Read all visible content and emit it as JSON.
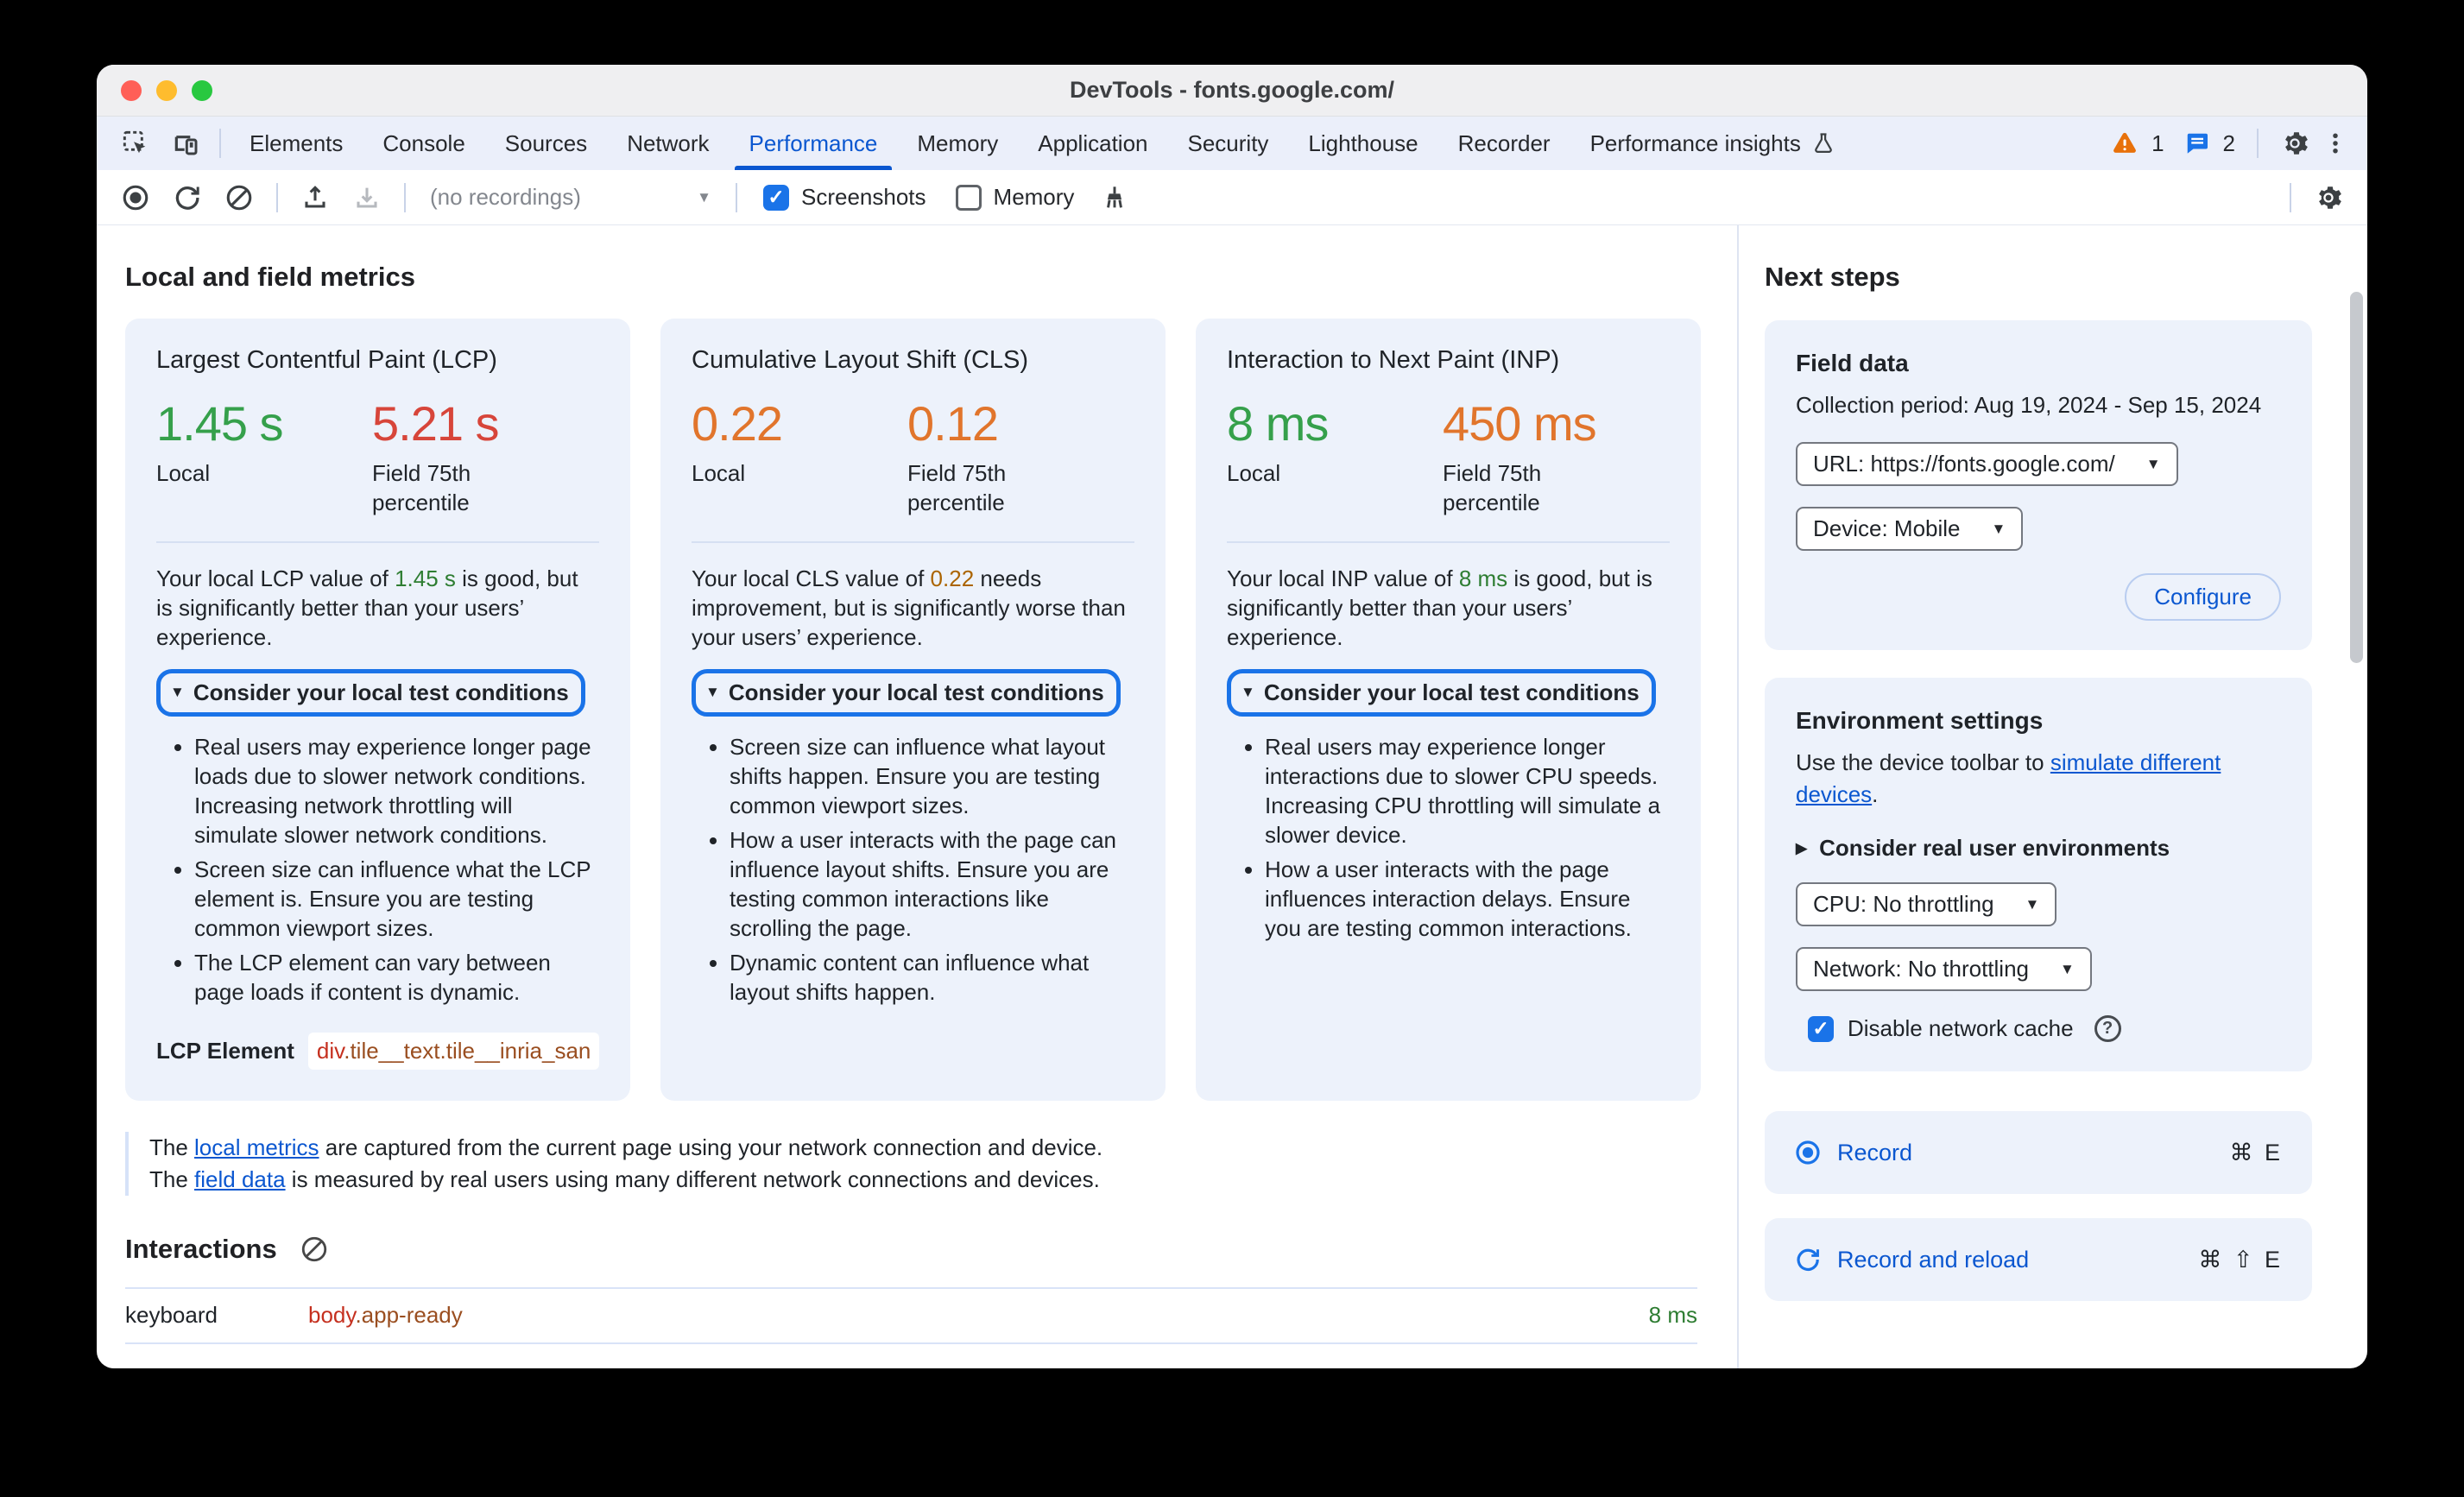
{
  "colors": {
    "accent_blue": "#1a73e8",
    "link_blue": "#0b57d0",
    "good_green": "#35a04b",
    "poor_red": "#d7453a",
    "needs_improvement_orange": "#e1752c",
    "warning_orange": "#e8710a"
  },
  "window": {
    "title": "DevTools - fonts.google.com/"
  },
  "tabbar": {
    "tabs": [
      {
        "label": "Elements"
      },
      {
        "label": "Console"
      },
      {
        "label": "Sources"
      },
      {
        "label": "Network"
      },
      {
        "label": "Performance"
      },
      {
        "label": "Memory"
      },
      {
        "label": "Application"
      },
      {
        "label": "Security"
      },
      {
        "label": "Lighthouse"
      },
      {
        "label": "Recorder"
      },
      {
        "label": "Performance insights"
      }
    ],
    "warning_count": "1",
    "message_count": "2"
  },
  "toolbar": {
    "recordings_select": "(no recordings)",
    "screenshots_label": "Screenshots",
    "memory_label": "Memory"
  },
  "main": {
    "heading": "Local and field metrics",
    "cards": [
      {
        "title": "Largest Contentful Paint (LCP)",
        "local_value": "1.45 s",
        "local_label": "Local",
        "field_value": "5.21 s",
        "field_label": "Field 75th percentile",
        "desc_prefix": "Your local LCP value of ",
        "desc_value": "1.45 s",
        "desc_suffix": " is good, but is significantly better than your users’ experience.",
        "disclosure": "Consider your local test conditions",
        "bullets": [
          "Real users may experience longer page loads due to slower network conditions. Increasing network throttling will simulate slower network conditions.",
          "Screen size can influence what the LCP element is. Ensure you are testing common viewport sizes.",
          "The LCP element can vary between page loads if content is dynamic."
        ],
        "lcp_label": "LCP Element",
        "lcp_tag": "div",
        "lcp_classes": ".tile__text.tile__inria_san"
      },
      {
        "title": "Cumulative Layout Shift (CLS)",
        "local_value": "0.22",
        "local_label": "Local",
        "field_value": "0.12",
        "field_label": "Field 75th percentile",
        "desc_prefix": "Your local CLS value of ",
        "desc_value": "0.22",
        "desc_suffix": " needs improvement, but is significantly worse than your users’ experience.",
        "disclosure": "Consider your local test conditions",
        "bullets": [
          "Screen size can influence what layout shifts happen. Ensure you are testing common viewport sizes.",
          "How a user interacts with the page can influence layout shifts. Ensure you are testing common interactions like scrolling the page.",
          "Dynamic content can influence what layout shifts happen."
        ]
      },
      {
        "title": "Interaction to Next Paint (INP)",
        "local_value": "8 ms",
        "local_label": "Local",
        "field_value": "450 ms",
        "field_label": "Field 75th percentile",
        "desc_prefix": "Your local INP value of ",
        "desc_value": "8 ms",
        "desc_suffix": " is good, but is significantly better than your users’ experience.",
        "disclosure": "Consider your local test conditions",
        "bullets": [
          "Real users may experience longer interactions due to slower CPU speeds. Increasing CPU throttling will simulate a slower device.",
          "How a user interacts with the page influences interaction delays. Ensure you are testing common interactions."
        ]
      }
    ],
    "footnote": {
      "line1_prefix": "The ",
      "line1_link": "local metrics",
      "line1_suffix": " are captured from the current page using your network connection and device.",
      "line2_prefix": "The ",
      "line2_link": "field data",
      "line2_suffix": " is measured by real users using many different network connections and devices."
    },
    "interactions": {
      "heading": "Interactions",
      "row": {
        "type": "keyboard",
        "target_tag": "body",
        "target_classes": ".app-ready",
        "duration": "8 ms"
      }
    }
  },
  "sidebar": {
    "heading": "Next steps",
    "field_data": {
      "heading": "Field data",
      "collection_period": "Collection period: Aug 19, 2024 - Sep 15, 2024",
      "url_select": "URL: https://fonts.google.com/",
      "device_select": "Device: Mobile",
      "configure_label": "Configure"
    },
    "environment": {
      "heading": "Environment settings",
      "text_prefix": "Use the device toolbar to ",
      "text_link": "simulate different devices",
      "text_suffix": ".",
      "disclosure": "Consider real user environments",
      "cpu_select": "CPU: No throttling",
      "network_select": "Network: No throttling",
      "cache_checkbox_label": "Disable network cache"
    },
    "record": {
      "label": "Record",
      "shortcut": "⌘ E"
    },
    "record_reload": {
      "label": "Record and reload",
      "shortcut": "⌘ ⇧ E"
    }
  }
}
